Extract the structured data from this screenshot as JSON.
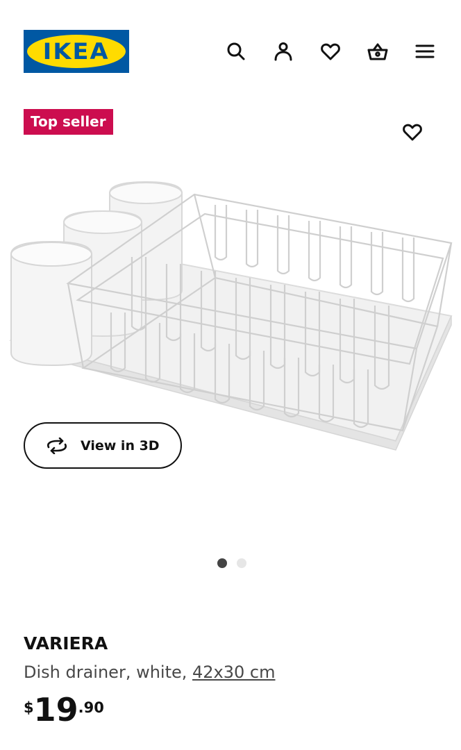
{
  "header": {
    "logo_text": "IKEA",
    "icons": [
      "search-icon",
      "account-icon",
      "heart-icon",
      "basket-icon",
      "menu-icon"
    ]
  },
  "badge": {
    "label": "Top seller"
  },
  "media": {
    "view_3d_label": "View in 3D",
    "image_count": 2,
    "active_image": 1
  },
  "product": {
    "name": "VARIERA",
    "description": "Dish drainer, white, ",
    "size_link": "42x30 cm",
    "price": {
      "currency": "$",
      "integer": "19",
      "decimal": ".90"
    }
  },
  "colors": {
    "logo_blue": "#0058a3",
    "logo_yellow": "#ffdb00",
    "badge_red": "#cc0d4f"
  }
}
